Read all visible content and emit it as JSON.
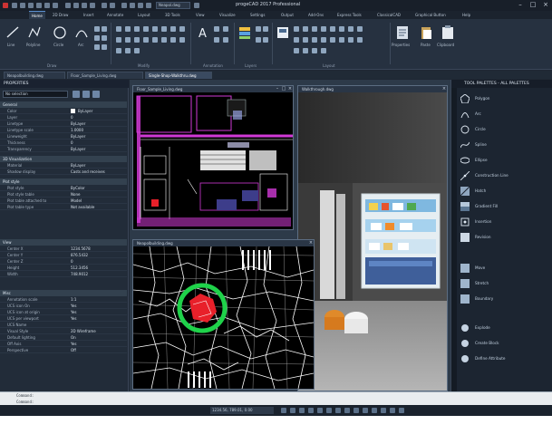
{
  "window": {
    "title": "progeCAD 2017 Professional",
    "active_doc_chip": "Neapol.dwg"
  },
  "ribbon": {
    "tabs": [
      {
        "label": "Home"
      },
      {
        "label": "2D Draw"
      },
      {
        "label": "Insert"
      },
      {
        "label": "Annotate"
      },
      {
        "label": "Layout"
      },
      {
        "label": "3D Tools"
      },
      {
        "label": "View"
      },
      {
        "label": "Visualize"
      },
      {
        "label": "Settings"
      },
      {
        "label": "Output"
      },
      {
        "label": "Add-Ons"
      },
      {
        "label": "Express Tools"
      },
      {
        "label": "ClassicalCAD"
      },
      {
        "label": "Graphical Button"
      },
      {
        "label": "Help"
      }
    ],
    "draw_buttons": [
      {
        "label": "Line"
      },
      {
        "label": "Polyline"
      },
      {
        "label": "Circle"
      },
      {
        "label": "Arc"
      }
    ],
    "groups": [
      "Draw",
      "Modify",
      "Annotation",
      "Layers",
      "Layout"
    ],
    "right_buttons": [
      {
        "label": "Properties"
      },
      {
        "label": "Paste"
      },
      {
        "label": "Clipboard"
      }
    ]
  },
  "doc_tabs": [
    {
      "label": "Neapolbuilding.dwg",
      "active": false
    },
    {
      "label": "Floor_Sample_Living.dwg",
      "active": false
    },
    {
      "label": "Single-Shop-Walkthru.dwg",
      "active": true
    }
  ],
  "properties": {
    "title": "PROPERTIES",
    "selection": "No selection",
    "categories": [
      {
        "name": "General",
        "rows": [
          {
            "k": "Color",
            "v": "ByLayer",
            "swatch": "#ffffff"
          },
          {
            "k": "Layer",
            "v": "0"
          },
          {
            "k": "Linetype",
            "v": "ByLayer"
          },
          {
            "k": "Linetype scale",
            "v": "1.0000"
          },
          {
            "k": "Lineweight",
            "v": "ByLayer"
          },
          {
            "k": "Thickness",
            "v": "0"
          },
          {
            "k": "Transparency",
            "v": "ByLayer"
          }
        ]
      },
      {
        "name": "3D Visualization",
        "rows": [
          {
            "k": "Material",
            "v": "ByLayer"
          },
          {
            "k": "Shadow display",
            "v": "Casts and receives"
          }
        ]
      },
      {
        "name": "Plot style",
        "rows": [
          {
            "k": "Plot style",
            "v": "ByColor"
          },
          {
            "k": "Plot style table",
            "v": "None"
          },
          {
            "k": "Plot table attached to",
            "v": "Model"
          },
          {
            "k": "Plot table type",
            "v": "Not available"
          }
        ]
      },
      {
        "name": "View",
        "rows": [
          {
            "k": "Center X",
            "v": "1234.5678"
          },
          {
            "k": "Center Y",
            "v": "876.5432"
          },
          {
            "k": "Center Z",
            "v": "0"
          },
          {
            "k": "Height",
            "v": "512.3456"
          },
          {
            "k": "Width",
            "v": "748.9012"
          }
        ]
      },
      {
        "name": "Misc",
        "rows": [
          {
            "k": "Annotation scale",
            "v": "1:1"
          },
          {
            "k": "UCS icon On",
            "v": "Yes"
          },
          {
            "k": "UCS icon at origin",
            "v": "Yes"
          },
          {
            "k": "UCS per viewport",
            "v": "Yes"
          },
          {
            "k": "UCS Name",
            "v": ""
          },
          {
            "k": "Visual Style",
            "v": "2D Wireframe"
          },
          {
            "k": "Default lighting",
            "v": "On"
          },
          {
            "k": "Off Axis",
            "v": "Yes"
          },
          {
            "k": "Perspective",
            "v": "Off"
          }
        ]
      }
    ]
  },
  "viewports": {
    "plan": {
      "title": "Floor_Sample_Living.dwg"
    },
    "render": {
      "title": "Walkthrough.dwg"
    },
    "map": {
      "title": "Neapolbuilding.dwg"
    }
  },
  "palette": {
    "title": "TOOL PALETTES - ALL PALETTES",
    "items": [
      {
        "label": "Polygon",
        "icon": "polygon-icon"
      },
      {
        "label": "Arc",
        "icon": "arc-icon"
      },
      {
        "label": "Circle",
        "icon": "circle-icon"
      },
      {
        "label": "Spline",
        "icon": "spline-icon"
      },
      {
        "label": "Ellipse",
        "icon": "ellipse-icon"
      },
      {
        "label": "Construction Line",
        "icon": "xline-icon"
      },
      {
        "label": "Hatch",
        "icon": "hatch-icon"
      },
      {
        "label": "Gradient Fill",
        "icon": "gradient-icon"
      },
      {
        "label": "Insertion",
        "icon": "insert-icon"
      },
      {
        "label": "Revision",
        "icon": "revision-icon"
      },
      {
        "label": "Move",
        "icon": "move-icon"
      },
      {
        "label": "Stretch",
        "icon": "stretch-icon"
      },
      {
        "label": "Boundary",
        "icon": "boundary-icon"
      },
      {
        "label": "Explode",
        "icon": "explode-icon"
      },
      {
        "label": "Create Block",
        "icon": "block-icon"
      },
      {
        "label": "Define Attribute",
        "icon": "attribute-icon"
      }
    ]
  },
  "command": {
    "line1": "Command:",
    "line2": "Command:"
  },
  "status": {
    "coords": "1234.56, 789.01, 0.00"
  },
  "colors": {
    "accent": "#5b8fd0",
    "ui_dark": "#1f2733",
    "magenta": "#d13ad6",
    "highlight_red": "#e8202a",
    "highlight_green": "#1fd24a"
  }
}
